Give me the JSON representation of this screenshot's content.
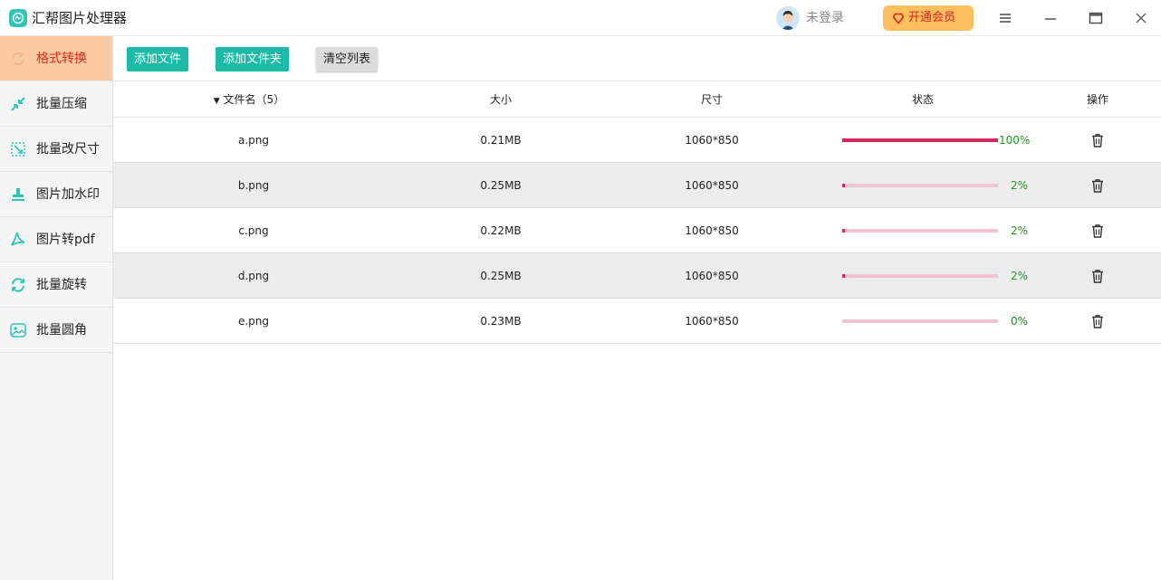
{
  "app": {
    "title": "汇帮图片处理器"
  },
  "header": {
    "login_text": "未登录",
    "vip_label": "开通会员",
    "vip_color": "#ffbf5e"
  },
  "sidebar": {
    "items": [
      {
        "label": "格式转换",
        "icon": "refresh-format-icon",
        "active": true
      },
      {
        "label": "批量压缩",
        "icon": "compress-icon",
        "active": false
      },
      {
        "label": "批量改尺寸",
        "icon": "resize-icon",
        "active": false
      },
      {
        "label": "图片加水印",
        "icon": "watermark-stamp-icon",
        "active": false
      },
      {
        "label": "图片转pdf",
        "icon": "pdf-icon",
        "active": false
      },
      {
        "label": "批量旋转",
        "icon": "rotate-icon",
        "active": false
      },
      {
        "label": "批量圆角",
        "icon": "image-rounded-icon",
        "active": false
      }
    ]
  },
  "toolbar": {
    "add_file": "添加文件",
    "add_folder": "添加文件夹",
    "clear_list": "清空列表"
  },
  "table": {
    "columns": {
      "filename": "文件名（5）",
      "size": "大小",
      "dimensions": "尺寸",
      "status": "状态",
      "action": "操作"
    },
    "rows": [
      {
        "name": "a.png",
        "size": "0.21MB",
        "dims": "1060*850",
        "progress": 100,
        "pct": "100%"
      },
      {
        "name": "b.png",
        "size": "0.25MB",
        "dims": "1060*850",
        "progress": 2,
        "pct": "2%"
      },
      {
        "name": "c.png",
        "size": "0.22MB",
        "dims": "1060*850",
        "progress": 2,
        "pct": "2%"
      },
      {
        "name": "d.png",
        "size": "0.25MB",
        "dims": "1060*850",
        "progress": 2,
        "pct": "2%"
      },
      {
        "name": "e.png",
        "size": "0.23MB",
        "dims": "1060*850",
        "progress": 0,
        "pct": "0%"
      }
    ]
  },
  "colors": {
    "accent": "#1dbba7",
    "active_tab": "#fbcaa2",
    "progress": "#d6285f",
    "progress_track": "#f2c4d2",
    "pct_text": "#1f9a1f"
  }
}
